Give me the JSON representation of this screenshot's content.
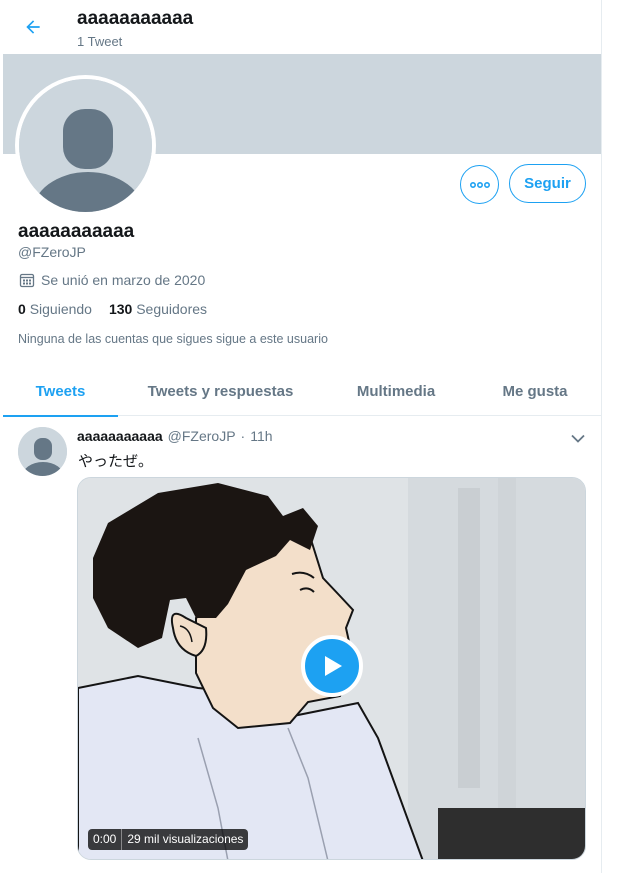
{
  "header": {
    "title": "aaaaaaaaaaa",
    "subtitle": "1 Tweet"
  },
  "profile": {
    "display_name": "aaaaaaaaaaa",
    "handle": "@FZeroJP",
    "joined": "Se unió en marzo de 2020",
    "following_count": "0",
    "following_label": "Siguiendo",
    "followers_count": "130",
    "followers_label": "Seguidores",
    "followed_note": "Ninguna de las cuentas que sigues sigue a este usuario",
    "follow_button": "Seguir"
  },
  "tabs": [
    {
      "label": "Tweets",
      "active": true
    },
    {
      "label": "Tweets y respuestas",
      "active": false
    },
    {
      "label": "Multimedia",
      "active": false
    },
    {
      "label": "Me gusta",
      "active": false
    }
  ],
  "tweet": {
    "name": "aaaaaaaaaaa",
    "handle": "@FZeroJP",
    "separator": "·",
    "time": "11h",
    "text": "やったぜ。",
    "video_time": "0:00",
    "video_views": "29 mil visualizaciones"
  },
  "colors": {
    "accent": "#1da1f2",
    "banner": "#ccd6dd",
    "secondary_text": "#657786"
  },
  "icons": {
    "back": "arrow-left-icon",
    "more": "more-horizontal-icon",
    "calendar": "calendar-icon",
    "caret": "chevron-down-icon",
    "play": "play-icon"
  }
}
